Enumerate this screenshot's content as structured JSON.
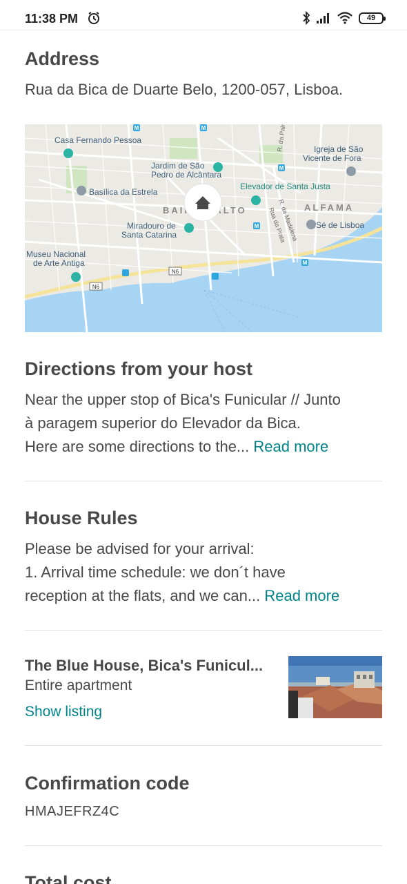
{
  "status_bar": {
    "time": "11:38 PM",
    "battery": "49",
    "icons": [
      "alarm-icon",
      "bluetooth-icon",
      "signal-icon",
      "wifi-icon",
      "battery-icon"
    ]
  },
  "address": {
    "title": "Address",
    "text": "Rua da Bica de Duarte Belo, 1200-057, Lisboa."
  },
  "map": {
    "labels": {
      "casa_fernando_pessoa": "Casa Fernando Pessoa",
      "jardim_line1": "Jardim de São",
      "jardim_line2": "Pedro de Alcântara",
      "igreja_line1": "Igreja de São",
      "igreja_line2": "Vicente de Fora",
      "r_palma": "R. da Palma",
      "basilica": "Basílica da Estrela",
      "elevador_santa_justa": "Elevador de Santa Justa",
      "bairro_alto": "BAIRRO ALTO",
      "alfama": "ALFAMA",
      "miradouro_line1": "Miradouro de",
      "miradouro_line2": "Santa Catarina",
      "r_madalena": "R. da Madalena",
      "rua_prata": "Rua da Prata",
      "se_lisboa": "Sé de Lisboa",
      "museu_line1": "Museu Nacional",
      "museu_line2": "de Arte Antiga",
      "n6_a": "N6",
      "n6_b": "N6"
    },
    "colors": {
      "land": "#eceae4",
      "water": "#a8d4f4",
      "road": "#ffffff",
      "major_road": "#f5e39a",
      "park": "#cfe6c0",
      "poi": "#2bb3a3",
      "metro": "#2ea6e0"
    }
  },
  "directions": {
    "title": "Directions from your host",
    "line1": "Near the upper stop of Bica's Funicular // Junto",
    "line2": "à paragem superior do Elevador da Bica.",
    "line3": "Here are some directions to the...",
    "read_more": "Read more"
  },
  "house_rules": {
    "title": "House Rules",
    "line1": "Please be advised for your arrival:",
    "line2": "1. Arrival time schedule: we don´t have",
    "line3": "reception at the flats, and we can...",
    "read_more": "Read more"
  },
  "listing": {
    "name": "The Blue House, Bica's Funicul...",
    "type": "Entire apartment",
    "show_listing": "Show listing"
  },
  "confirmation": {
    "title": "Confirmation code",
    "code": "HMAJEFRZ4C"
  },
  "total_cost": {
    "title": "Total cost"
  },
  "colors": {
    "text": "#484848",
    "link": "#008489",
    "divider": "#e4e4e4"
  }
}
